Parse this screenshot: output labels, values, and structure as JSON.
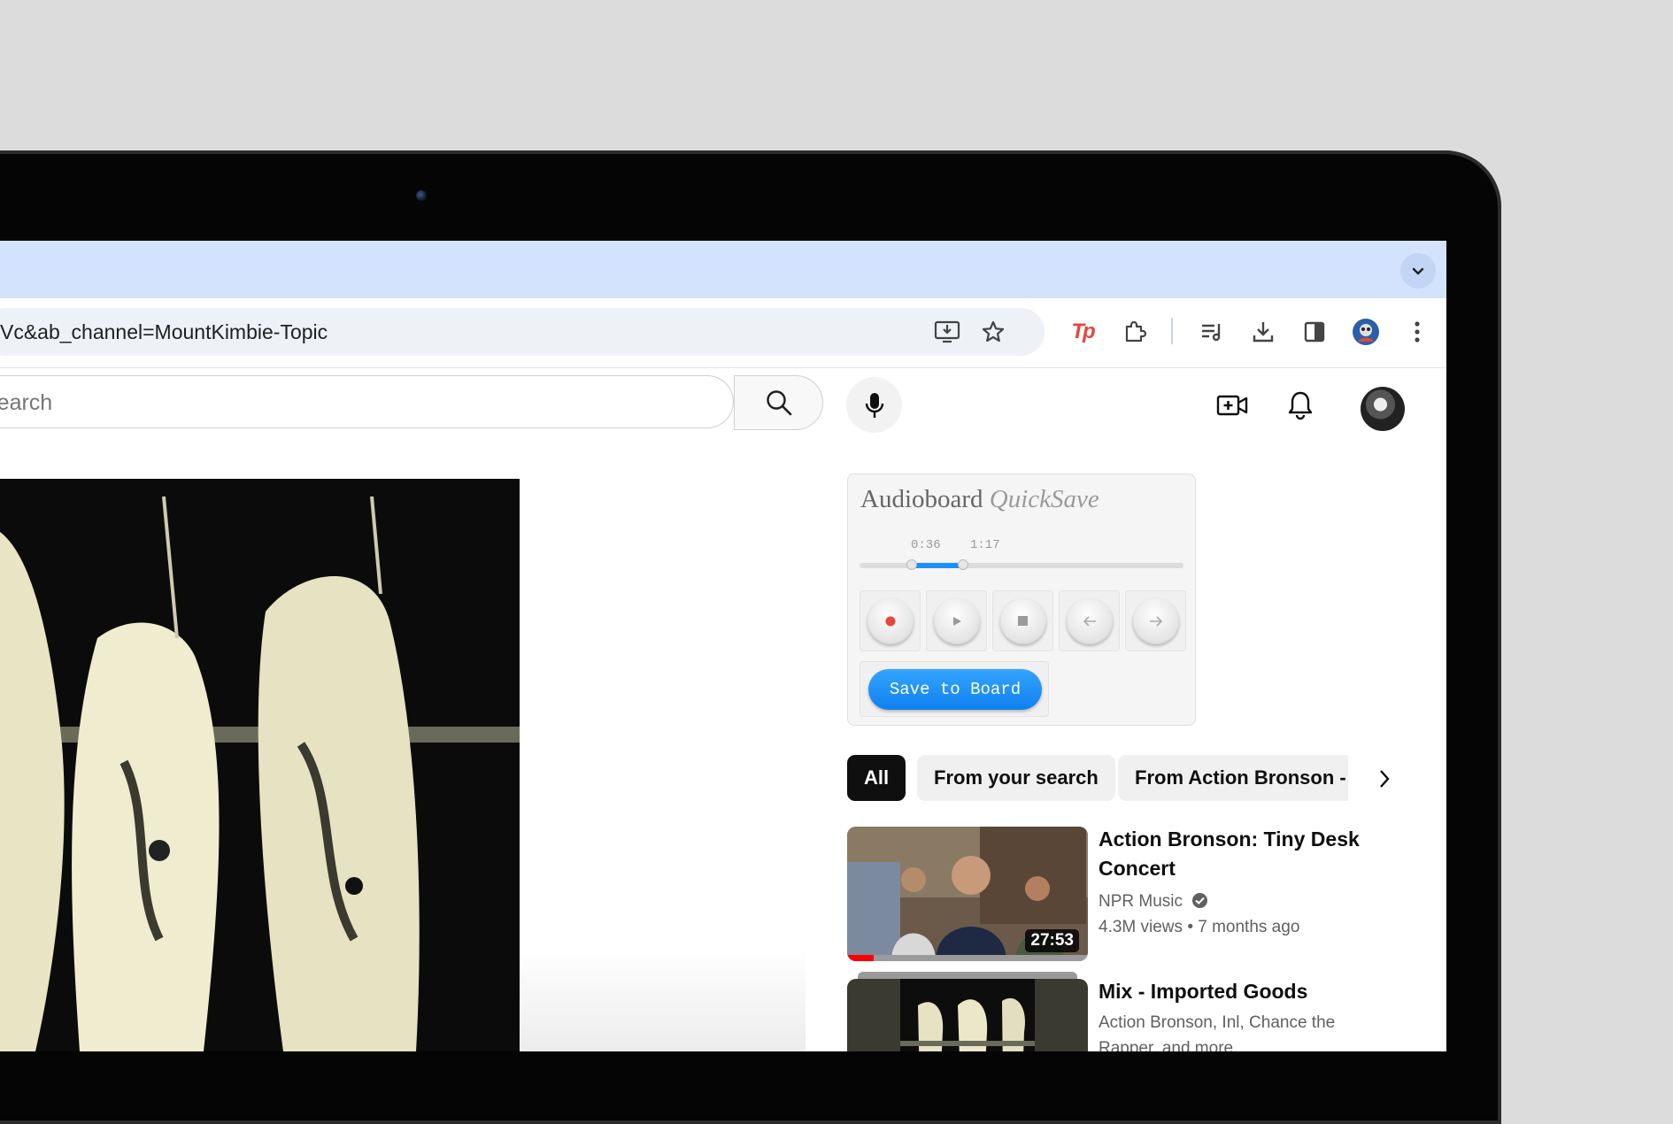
{
  "browser": {
    "url": "Vc&ab_channel=MountKimbie-Topic",
    "icons": [
      "install-app-icon",
      "bookmark-star-icon",
      "tp-extension-icon",
      "extensions-puzzle-icon",
      "reading-list-icon",
      "downloads-icon",
      "side-panel-icon",
      "profile-avatar",
      "kebab-menu-icon"
    ],
    "tp_label": "Tp"
  },
  "youtube": {
    "search_placeholder": "Search",
    "header_icons": [
      "search-icon",
      "mic-icon",
      "create-video-icon",
      "notifications-bell-icon",
      "account-avatar"
    ]
  },
  "audioboard": {
    "title": "Audioboard",
    "title_italic": "QuickSave",
    "start_time": "0:36",
    "end_time": "1:17",
    "selection_start_fraction": 0.16,
    "selection_end_fraction": 0.32,
    "save_label": "Save to Board",
    "accent": "#1e8fff",
    "record_color": "#e8453c"
  },
  "chips": [
    "All",
    "From your search",
    "From Action Bronson - T"
  ],
  "recommendations": [
    {
      "title": "Action Bronson: Tiny Desk Concert",
      "channel": "NPR Music",
      "views": "4.3M views",
      "age": "7 months ago",
      "duration": "27:53"
    },
    {
      "title": "Mix - Imported Goods",
      "meta_line1": "Action Bronson, Inl, Chance the",
      "meta_line2": "Rapper, and more"
    }
  ]
}
